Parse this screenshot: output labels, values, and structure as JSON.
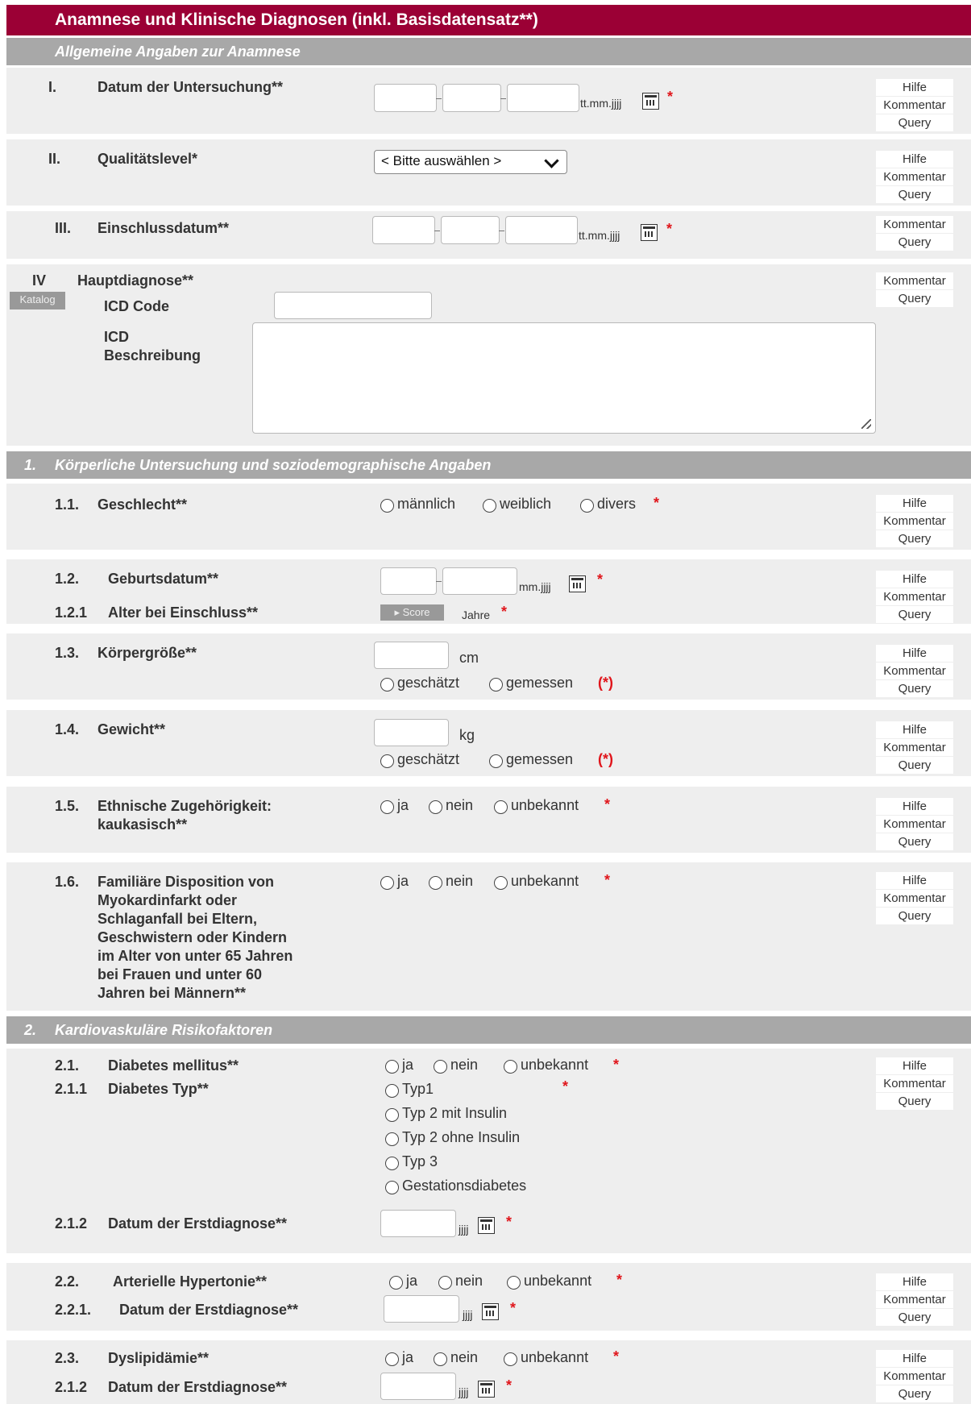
{
  "header": {
    "title": "Anamnese und Klinische Diagnosen (inkl. Basisdatensatz**)"
  },
  "buttons": {
    "help": "Hilfe",
    "comment": "Kommentar",
    "query": "Query",
    "catalog": "Katalog",
    "score": "Score"
  },
  "section0": {
    "title": "Allgemeine Angaben zur Anamnese"
  },
  "rowI": {
    "num": "I.",
    "label": "Datum der Untersuchung**",
    "format": "tt.mm.jjjj"
  },
  "rowII": {
    "num": "II.",
    "label": "Qualitätslevel*",
    "select_value": "< Bitte auswählen >"
  },
  "rowIII": {
    "num": "III.",
    "label": "Einschlussdatum**",
    "format": "tt.mm.jjjj"
  },
  "rowIV": {
    "num": "IV",
    "label": "Hauptdiagnose**",
    "icd_code_label": "ICD Code",
    "icd_desc_label_1": "ICD",
    "icd_desc_label_2": "Beschreibung"
  },
  "section1": {
    "num": "1.",
    "title": "Körperliche Untersuchung und soziodemographische Angaben"
  },
  "r11": {
    "num": "1.1.",
    "label": "Geschlecht**",
    "options": [
      "männlich",
      "weiblich",
      "divers"
    ]
  },
  "r12": {
    "num": "1.2.",
    "label": "Geburtsdatum**",
    "format": "mm.jjjj",
    "sub_num": "1.2.1",
    "sub_label": "Alter bei Einschluss**",
    "unit": "Jahre"
  },
  "r13": {
    "num": "1.3.",
    "label": "Körpergröße**",
    "unit": "cm",
    "opt1": "geschätzt",
    "opt2": "gemessen",
    "note": "(*)"
  },
  "r14": {
    "num": "1.4.",
    "label": "Gewicht**",
    "unit": "kg",
    "opt1": "geschätzt",
    "opt2": "gemessen",
    "note": "(*)"
  },
  "r15": {
    "num": "1.5.",
    "label_1": "Ethnische Zugehörigkeit:",
    "label_2": "kaukasisch**",
    "options": [
      "ja",
      "nein",
      "unbekannt"
    ]
  },
  "r16": {
    "num": "1.6.",
    "label_lines": [
      "Familiäre Disposition von",
      "Myokardinfarkt oder",
      "Schlaganfall bei Eltern,",
      "Geschwistern oder Kindern",
      "im Alter von unter 65 Jahren",
      "bei Frauen und unter 60",
      "Jahren bei Männern**"
    ],
    "options": [
      "ja",
      "nein",
      "unbekannt"
    ]
  },
  "section2": {
    "num": "2.",
    "title": "Kardiovaskuläre Risikofaktoren"
  },
  "r21": {
    "num": "2.1.",
    "label": "Diabetes mellitus**",
    "options": [
      "ja",
      "nein",
      "unbekannt"
    ],
    "sub_num": "2.1.1",
    "sub_label": "Diabetes Typ**",
    "types": [
      "Typ1",
      "Typ 2 mit Insulin",
      "Typ 2 ohne Insulin",
      "Typ 3",
      "Gestationsdiabetes"
    ],
    "date_num": "2.1.2",
    "date_label": "Datum der Erstdiagnose**",
    "format": "jjjj"
  },
  "r22": {
    "num": "2.2.",
    "label": "Arterielle Hypertonie**",
    "options": [
      "ja",
      "nein",
      "unbekannt"
    ],
    "sub_num": "2.2.1.",
    "sub_label": "Datum der Erstdiagnose**",
    "format": "jjjj"
  },
  "r23": {
    "num": "2.3.",
    "label": "Dyslipidämie**",
    "options": [
      "ja",
      "nein",
      "unbekannt"
    ],
    "sub_num": "2.1.2",
    "sub_label": "Datum der Erstdiagnose**",
    "format": "jjjj"
  },
  "star": "*"
}
